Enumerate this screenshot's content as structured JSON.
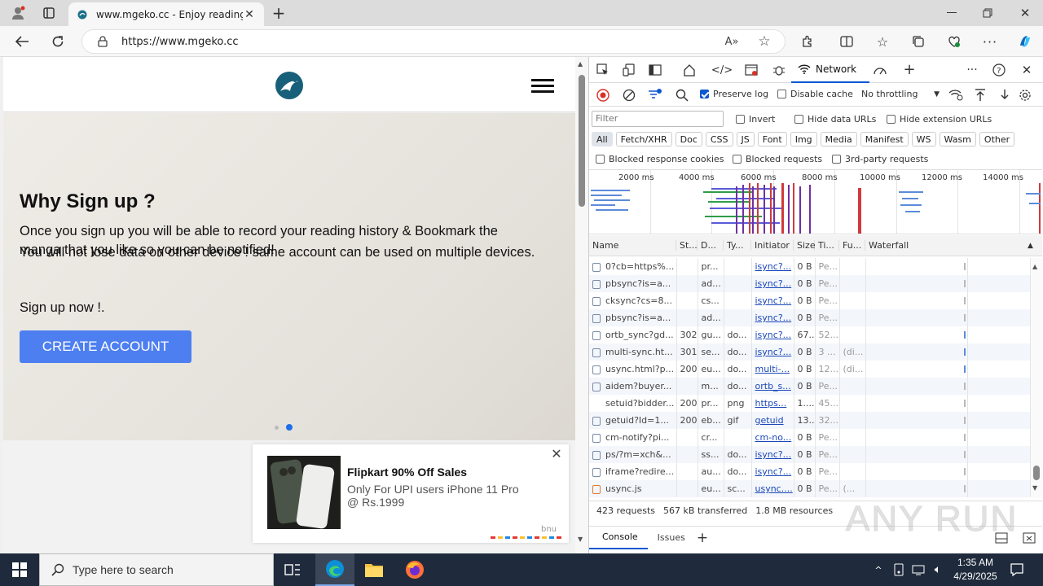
{
  "browser": {
    "tab_title": "www.mgeko.cc - Enjoy reading",
    "url": "https://www.mgeko.cc"
  },
  "page": {
    "heading": "Why Sign up ?",
    "para1": "Once you sign up you will be able to record your reading history & Bookmark the manga that you like so you can be notified!",
    "para2": "You will not lose data on other device ! same account can be used on multiple devices.",
    "para3": "Sign up now !.",
    "cta": "CREATE ACCOUNT",
    "ad": {
      "title": "Flipkart 90% Off Sales",
      "line1": "Only For UPI users iPhone 11 Pro",
      "line2": "@ Rs.1999",
      "brand": "bnu"
    }
  },
  "devtools": {
    "active_tab": "Network",
    "preserve_log": "Preserve log",
    "disable_cache": "Disable cache",
    "throttling": "No throttling",
    "filter_placeholder": "Filter",
    "invert": "Invert",
    "hide_data_urls": "Hide data URLs",
    "hide_extension_urls": "Hide extension URLs",
    "type_filters": [
      "All",
      "Fetch/XHR",
      "Doc",
      "CSS",
      "JS",
      "Font",
      "Img",
      "Media",
      "Manifest",
      "WS",
      "Wasm",
      "Other"
    ],
    "blocked_response_cookies": "Blocked response cookies",
    "blocked_requests": "Blocked requests",
    "third_party": "3rd-party requests",
    "timeline_ticks": [
      "2000 ms",
      "4000 ms",
      "6000 ms",
      "8000 ms",
      "10000 ms",
      "12000 ms",
      "14000 ms"
    ],
    "columns": [
      "Name",
      "St...",
      "D...",
      "Ty...",
      "Initiator",
      "Size",
      "Ti...",
      "Fu...",
      "Waterfall"
    ],
    "rows": [
      [
        "0?cb=https%...",
        "",
        "pr...",
        "",
        "isync?...",
        "0 B",
        "Pe...",
        ""
      ],
      [
        "pbsync?is=a...",
        "",
        "ad...",
        "",
        "isync?...",
        "0 B",
        "Pe...",
        ""
      ],
      [
        "cksync?cs=8...",
        "",
        "cs...",
        "",
        "isync?...",
        "0 B",
        "Pe...",
        ""
      ],
      [
        "pbsync?is=a...",
        "",
        "ad...",
        "",
        "isync?...",
        "0 B",
        "Pe...",
        ""
      ],
      [
        "ortb_sync?gd...",
        "302",
        "gu...",
        "do...",
        "isync?...",
        "67...",
        "52...",
        ""
      ],
      [
        "multi-sync.ht...",
        "301",
        "se...",
        "do...",
        "isync?...",
        "0 B",
        "3 ...",
        "(di..."
      ],
      [
        "usync.html?p...",
        "200",
        "eu...",
        "do...",
        "multi-...",
        "0 B",
        "12...",
        "(di..."
      ],
      [
        "aidem?buyer...",
        "",
        "m...",
        "do...",
        "ortb_s...",
        "0 B",
        "Pe...",
        ""
      ],
      [
        "setuid?bidder...",
        "200",
        "pr...",
        "png",
        "https...",
        "1....",
        "45...",
        ""
      ],
      [
        "getuid?Id=1...",
        "200",
        "eb...",
        "gif",
        "getuid",
        "13...",
        "32...",
        ""
      ],
      [
        "cm-notify?pi...",
        "",
        "cr...",
        "",
        "cm-no...",
        "0 B",
        "Pe...",
        ""
      ],
      [
        "ps/?m=xch&...",
        "",
        "ss...",
        "do...",
        "isync?...",
        "0 B",
        "Pe...",
        ""
      ],
      [
        "iframe?redire...",
        "",
        "au...",
        "do...",
        "isync?...",
        "0 B",
        "Pe...",
        ""
      ],
      [
        "usync.js",
        "",
        "eu...",
        "sc...",
        "usync....",
        "0 B",
        "Pe...",
        "(..."
      ]
    ],
    "summary_requests": "423 requests",
    "summary_transferred": "567 kB transferred",
    "summary_resources": "1.8 MB resources",
    "drawer_console": "Console",
    "drawer_issues": "Issues"
  },
  "taskbar": {
    "search_placeholder": "Type here to search",
    "time": "1:35 AM",
    "date": "4/29/2025"
  },
  "watermark": "ANY RUN"
}
